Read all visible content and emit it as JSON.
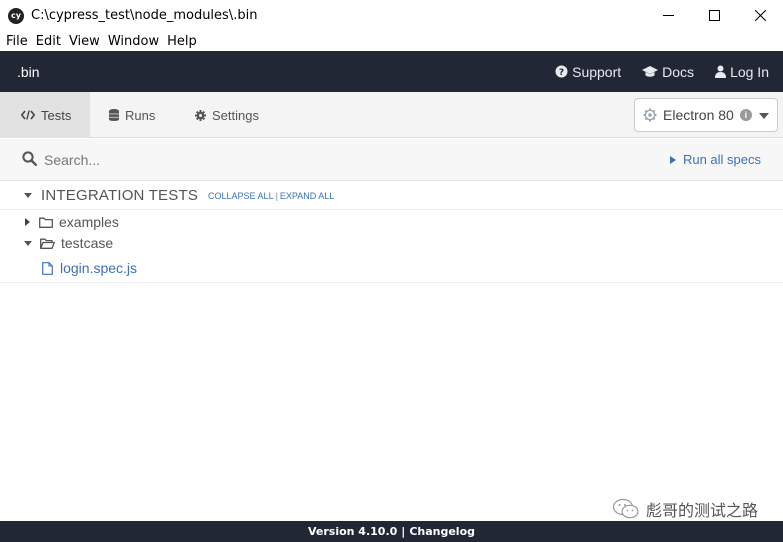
{
  "window": {
    "logo_text": "cy",
    "title": "C:\\cypress_test\\node_modules\\.bin",
    "controls": [
      "minimize",
      "maximize",
      "close"
    ]
  },
  "menu": {
    "items": [
      "File",
      "Edit",
      "View",
      "Window",
      "Help"
    ]
  },
  "header": {
    "project_name": ".bin",
    "links": {
      "support": "Support",
      "docs": "Docs",
      "login": "Log In"
    }
  },
  "nav": {
    "tabs": {
      "tests": "Tests",
      "runs": "Runs",
      "settings": "Settings"
    },
    "active_tab": "tests",
    "browser": {
      "label": "Electron 80",
      "info": "i"
    }
  },
  "search": {
    "placeholder": "Search...",
    "value": "",
    "run_all_label": "Run all specs"
  },
  "specs": {
    "section_title": "INTEGRATION TESTS",
    "collapse_all": "COLLAPSE ALL",
    "divider": "|",
    "expand_all": "EXPAND ALL",
    "tree": {
      "examples": {
        "label": "examples",
        "expanded": false
      },
      "testcase": {
        "label": "testcase",
        "expanded": true
      },
      "login_spec": {
        "label": "login.spec.js"
      }
    }
  },
  "footer": {
    "version": "Version 4.10.0",
    "separator": "|",
    "changelog": "Changelog"
  },
  "watermark": {
    "text": "彪哥的测试之路"
  },
  "colors": {
    "header_bg": "#212735",
    "link_blue": "#3c71b9",
    "nav_bg": "#f4f4f4",
    "active_tab_bg": "#e2e2e2"
  }
}
